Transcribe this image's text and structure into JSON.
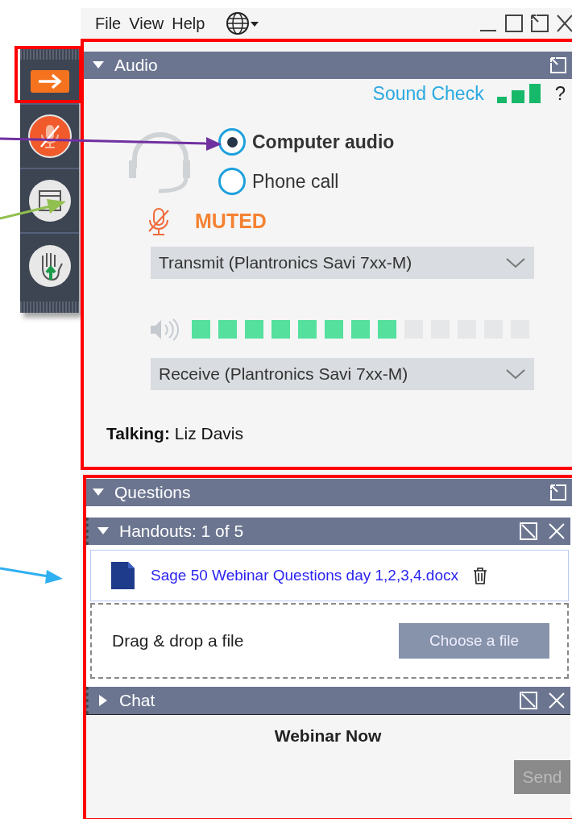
{
  "menu": [
    "File",
    "View",
    "Help"
  ],
  "audio": {
    "title": "Audio",
    "expanded": true,
    "sound_check": "Sound Check",
    "help": "?",
    "modes": [
      {
        "label": "Computer audio",
        "selected": true
      },
      {
        "label": "Phone call",
        "selected": false
      }
    ],
    "mic_status": "MUTED",
    "muted": true,
    "transmit": "Transmit (Plantronics Savi 7xx-M)",
    "speaker": {
      "level": 0.615
    },
    "receive": "Receive (Plantronics Savi 7xx-M)",
    "talking_label": "Talking:",
    "talking_name": "Liz Davis"
  },
  "questions": {
    "title": "Questions",
    "expanded": true
  },
  "handouts": {
    "title": "Handouts: 1 of 5",
    "expanded": true,
    "files": [
      {
        "name": "Sage 50 Webinar Questions day 1,2,3,4.docx"
      }
    ],
    "drop_hint": "Drag & drop a file",
    "choose_button": "Choose a file"
  },
  "chat": {
    "title": "Chat",
    "expanded": false,
    "webinar_name": "Webinar Now",
    "send_button": "Send",
    "send_disabled": true
  }
}
